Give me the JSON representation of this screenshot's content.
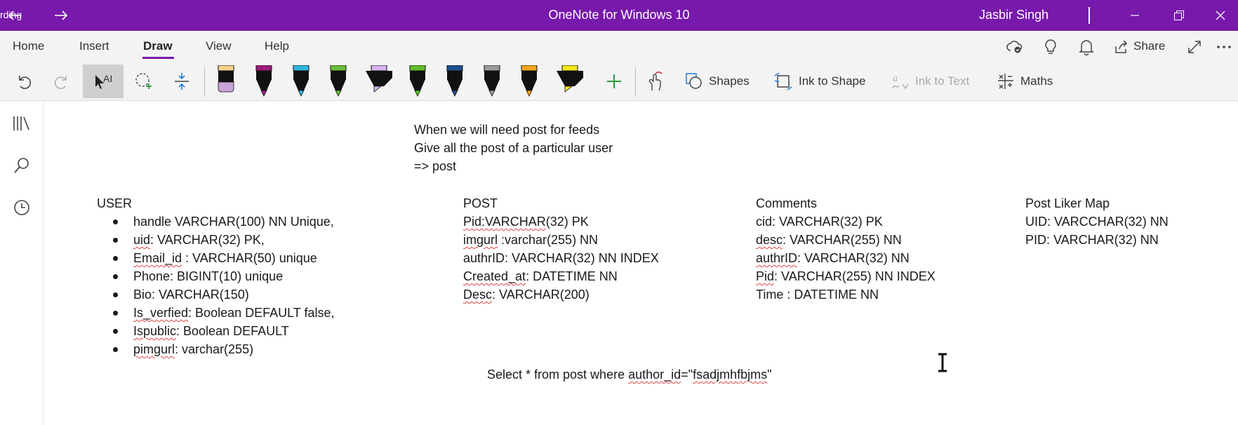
{
  "titlebar": {
    "left_stub": "rding",
    "app_title": "OneNote for Windows 10",
    "user_name": "Jasbir Singh",
    "icons": [
      "back-arrow-icon",
      "forward-arrow-icon",
      "minimize-icon",
      "restore-icon",
      "close-icon"
    ],
    "bg_color": "#7719aa"
  },
  "tabs": {
    "items": [
      "Home",
      "Insert",
      "Draw",
      "View",
      "Help"
    ],
    "active": "Draw",
    "share_label": "Share",
    "right_icons": [
      "sync-status-icon",
      "lightbulb-icon",
      "bell-icon",
      "share-icon",
      "expand-icon",
      "more-icon"
    ]
  },
  "toolbar": {
    "icons": [
      "undo-icon",
      "redo-icon",
      "text-select-icon",
      "lasso-select-icon",
      "add-space-icon"
    ],
    "pens": [
      {
        "name": "pen-black-lavender",
        "color": "#111111",
        "cap": "#f4d38a",
        "tip_color": "#c9a3d9",
        "type": "highlighter"
      },
      {
        "name": "pen-purple",
        "color": "#111111",
        "cap": "#9b1c7c",
        "tip_color": "#9b1c7c",
        "type": "pen"
      },
      {
        "name": "pen-blue",
        "color": "#111111",
        "cap": "#2fb6e0",
        "tip_color": "#2fb6e0",
        "type": "pen"
      },
      {
        "name": "pen-green",
        "color": "#111111",
        "cap": "#6abf3a",
        "tip_color": "#6abf3a",
        "type": "pen"
      },
      {
        "name": "highlighter-lavender",
        "color": "#111111",
        "cap": "#d7b3f0",
        "tip_color": "#d7b3f0",
        "type": "highlighter"
      },
      {
        "name": "pen-lime",
        "color": "#111111",
        "cap": "#5fbd2d",
        "tip_color": "#5fbd2d",
        "type": "pen"
      },
      {
        "name": "pen-navy",
        "color": "#111111",
        "cap": "#1e4f8c",
        "tip_color": "#1e4f8c",
        "type": "pen"
      },
      {
        "name": "pen-gray",
        "color": "#111111",
        "cap": "#9a9a9a",
        "tip_color": "#9a9a9a",
        "type": "pen"
      },
      {
        "name": "pen-orange",
        "color": "#111111",
        "cap": "#f2a51d",
        "tip_color": "#f2a51d",
        "type": "pen"
      },
      {
        "name": "highlighter-yellow",
        "color": "#111111",
        "cap": "#f5e61c",
        "tip_color": "#f5e61c",
        "type": "highlighter"
      }
    ],
    "add_pen_icon": "plus-icon",
    "touch_draw_icon": "touch-draw-icon",
    "shapes_label": "Shapes",
    "ink_to_shape_label": "Ink to Shape",
    "ink_to_text_label": "Ink to Text",
    "maths_label": "Maths"
  },
  "rail": {
    "icons": [
      "notebooks-icon",
      "search-icon",
      "recent-icon"
    ]
  },
  "note": {
    "intro": [
      "When we will need post for feeds",
      "Give all the post of a particular user",
      "=> post"
    ],
    "user": {
      "title": "USER",
      "items": [
        {
          "pre": "handle VARCHAR(100) NN Unique,",
          "squig": "",
          "post": ""
        },
        {
          "pre": "",
          "squig": "uid",
          "post": ": VARCHAR(32) PK,"
        },
        {
          "pre": "",
          "squig": "Email_id",
          "post": " : VARCHAR(50) unique"
        },
        {
          "pre": "Phone: BIGINT(10) unique",
          "squig": "",
          "post": ""
        },
        {
          "pre": "Bio: VARCHAR(150)",
          "squig": "",
          "post": ""
        },
        {
          "pre": "",
          "squig": "Is_verfied",
          "post": ": Boolean DEFAULT false,"
        },
        {
          "pre": "",
          "squig": "Ispublic",
          "post": ": Boolean DEFAULT"
        },
        {
          "pre": "",
          "squig": "pimgurl",
          "post": ": varchar(255)"
        }
      ]
    },
    "post": {
      "title": "POST",
      "lines": [
        {
          "squig": "Pid:VARCHAR",
          "post": "(32) PK"
        },
        {
          "squig": "imgurl",
          "post": " :varchar(255) NN"
        },
        {
          "squig": "",
          "post": "authrID: VARCHAR(32) NN INDEX"
        },
        {
          "squig": "Created_at",
          "post": ":  DATETIME NN"
        },
        {
          "squig": "Desc",
          "post": ": VARCHAR(200)"
        }
      ]
    },
    "comments": {
      "title": "Comments",
      "lines": [
        {
          "squig": "",
          "post": "cid: VARCHAR(32) PK"
        },
        {
          "squig": "desc",
          "post": ": VARCHAR(255) NN"
        },
        {
          "squig": "authrID",
          "post": ": VARCHAR(32) NN"
        },
        {
          "squig": "Pid",
          "post": ": VARCHAR(255) NN INDEX"
        },
        {
          "squig": "",
          "post": "Time : DATETIME NN"
        }
      ]
    },
    "liker_map": {
      "title": "Post Liker Map",
      "lines": [
        "UID: VARCCHAR(32) NN",
        "PID: VARCHAR(32) NN"
      ]
    },
    "query": {
      "pre": "Select * from post where ",
      "squig1": "author_id",
      "mid": "=\"",
      "squig2": "fsadjmhfbjms",
      "post": "\""
    }
  }
}
